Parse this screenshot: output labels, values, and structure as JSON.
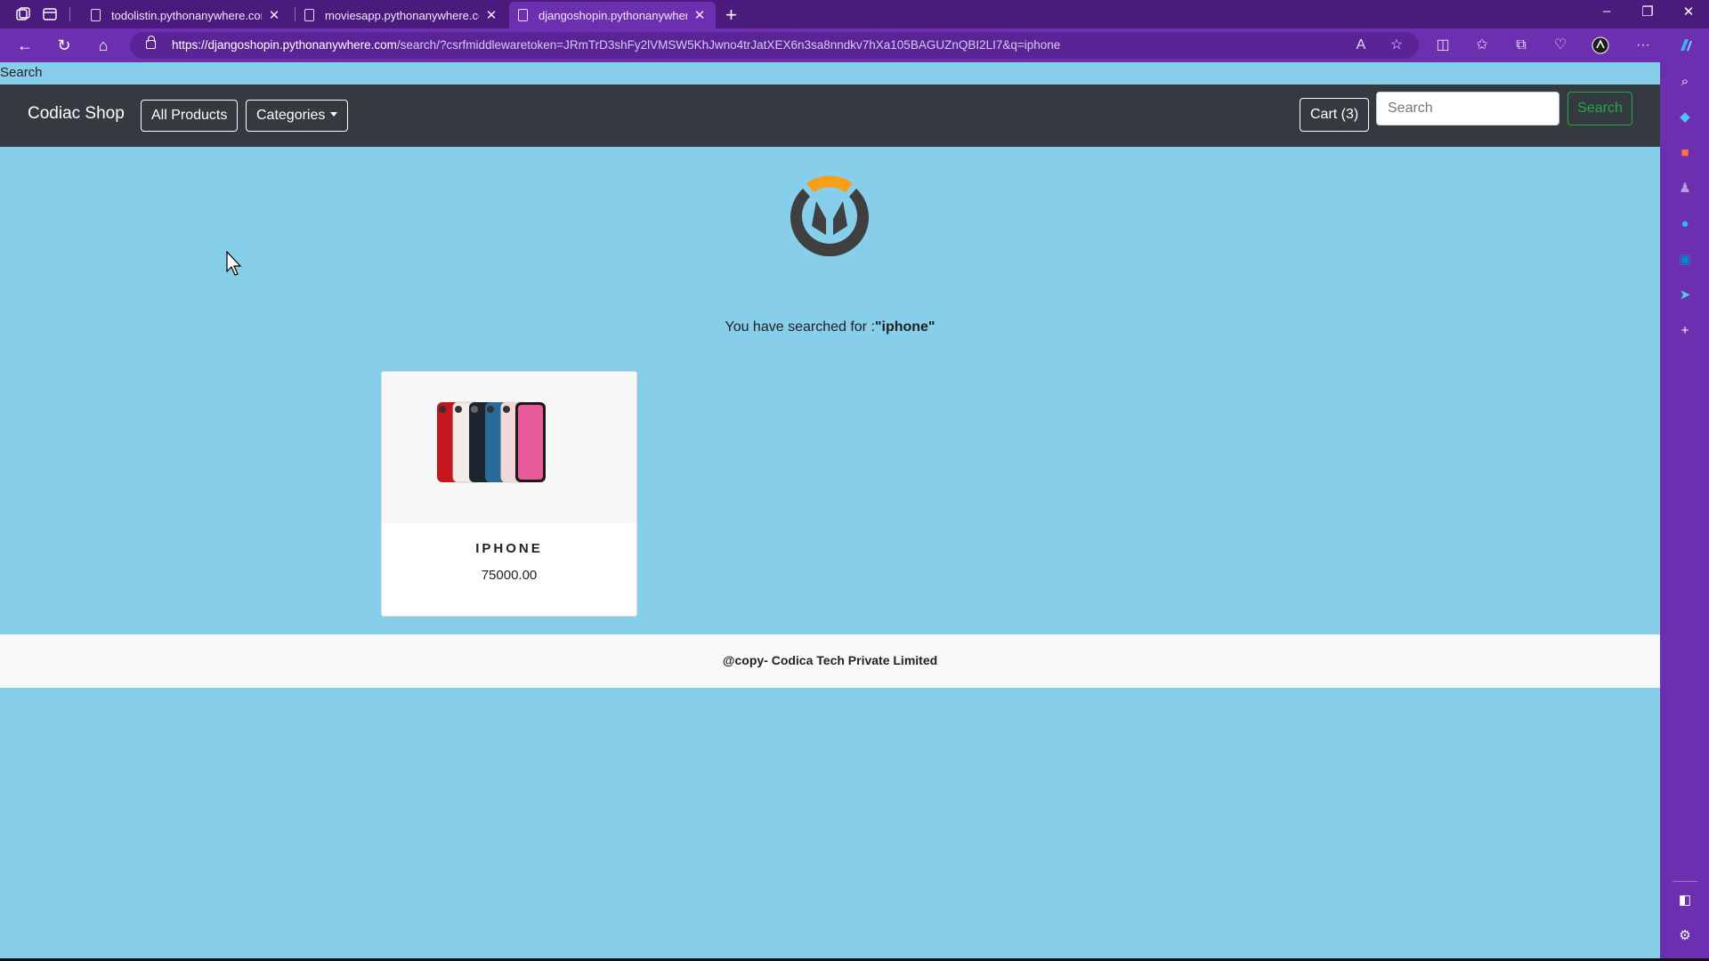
{
  "browser": {
    "tabs": [
      {
        "title": "todolistin.pythonanywhere.com",
        "active": false
      },
      {
        "title": "moviesapp.pythonanywhere.com",
        "active": false
      },
      {
        "title": "djangoshopin.pythonanywhere.c",
        "active": true
      }
    ],
    "url_host": "https://djangoshopin.pythonanywhere.com",
    "url_path": "/search/?csrfmiddlewaretoken=JRmTrD3shFy2lVMSW5KhJwno4trJatXEX6n3sa8nndkv7hXa105BAGUZnQBI2LI7&q=iphone",
    "accent_color": "#6b2fb0"
  },
  "page": {
    "header_text": "Search",
    "navbar": {
      "brand": "Codiac Shop",
      "all_products": "All Products",
      "categories": "Categories",
      "cart": "Cart (3)",
      "search_placeholder": "Search",
      "search_button": "Search"
    },
    "search_message_prefix": "You have searched for :",
    "search_query": "\"iphone\"",
    "products": [
      {
        "name": "IPHONE",
        "price": "75000.00"
      }
    ],
    "footer": "@copy- Codica Tech Private Limited",
    "background_color": "#87ceeb"
  }
}
